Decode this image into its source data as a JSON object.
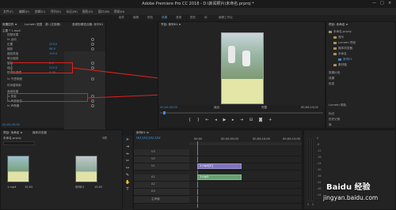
{
  "window": {
    "title": "Adobe Premiere Pro CC 2018 - D:\\新闻照片\\未命名.prproj *",
    "controls": [
      "—",
      "□",
      "×"
    ]
  },
  "menu": [
    "文件(F)",
    "编辑(E)",
    "剪辑(C)",
    "序列(S)",
    "标记(M)",
    "图形(G)",
    "窗口(W)",
    "帮助(H)"
  ],
  "workspaces": [
    "组件",
    "编辑",
    "颜色",
    "效果",
    "音频",
    "图形",
    "库",
    "编辑工作区"
  ],
  "effect_controls": {
    "tabs": [
      "效果控件 ≡",
      "Lumetri 范围",
      "源: (无剪辑)",
      "音频剪辑混合器: 序列01"
    ],
    "source_label": "主要 * 1.mp4",
    "rows": [
      {
        "label": "视频效果",
        "value": ""
      },
      {
        "label": "fx 运动",
        "value": ""
      },
      {
        "label": "位置",
        "value": "225.0"
      },
      {
        "label": "缩放",
        "value": "98.0"
      },
      {
        "label": "缩放宽度",
        "value": "100.0"
      },
      {
        "label": "等比缩放",
        "value": ""
      },
      {
        "label": "旋转",
        "value": "0.0"
      },
      {
        "label": "锚点",
        "value": "225.0"
      },
      {
        "label": "防闪烁滤镜",
        "value": "0.00"
      },
      {
        "label": "fx 不透明度",
        "value": ""
      },
      {
        "label": "时间重映射",
        "value": ""
      },
      {
        "label": "音频效果",
        "value": ""
      },
      {
        "label": "fx 音量",
        "value": ""
      },
      {
        "label": "fx 声道音量",
        "value": ""
      },
      {
        "label": "fx 声像器",
        "value": ""
      }
    ],
    "timecode": "00;00;00;00"
  },
  "program": {
    "title": "节目: 序列01 ≡",
    "timecode": "00;00;00;00",
    "fit": "适合",
    "quality": "完整",
    "duration": "00;00;15;02"
  },
  "project": {
    "title": "项目: 未命名 ≡",
    "items": [
      "未命名.prproj",
      "音乐",
      "Lumetri 预设",
      "媒体浏览器",
      "未命名",
      "序列01",
      "素材箱",
      "剪辑片段",
      "效果",
      "信息",
      "Lumetri 颜色",
      "标记",
      "历史记录",
      "库"
    ]
  },
  "media_browser": {
    "tabs": [
      "项目: 未命名 ≡",
      "媒体浏览器"
    ],
    "path": "未命名.prproj",
    "count": "2项",
    "thumbs": [
      {
        "name": "1.mp4",
        "duration": "15;02"
      },
      {
        "name": "序列01",
        "duration": "15;02"
      }
    ]
  },
  "timeline": {
    "title": "序列01 ≡",
    "timecode": "00;00;00;00",
    "ruler": [
      "00;00",
      "00;00;05;00",
      "00;00;10;00",
      "00;00;15;00"
    ],
    "tracks": [
      "V3",
      "V2",
      "V1",
      "A1",
      "A2",
      "A3",
      "主声道"
    ],
    "clip_label": "1.mp4[V]",
    "audio_clip_label": "1.mp4"
  },
  "meters": {
    "db_labels": [
      "0",
      "-6",
      "-12",
      "-18",
      "-24",
      "-30",
      "-36",
      "-42",
      "-48",
      "-54"
    ],
    "channels": [
      "S",
      "S"
    ]
  },
  "watermark": {
    "brand": "Baidu 经验",
    "url": "jingyan.baidu.com"
  },
  "colors": {
    "accent": "#3a8fd8",
    "highlight": "#e02020",
    "bg": "#232323",
    "clip_video": "#7f76b9",
    "clip_audio": "#64a070"
  }
}
